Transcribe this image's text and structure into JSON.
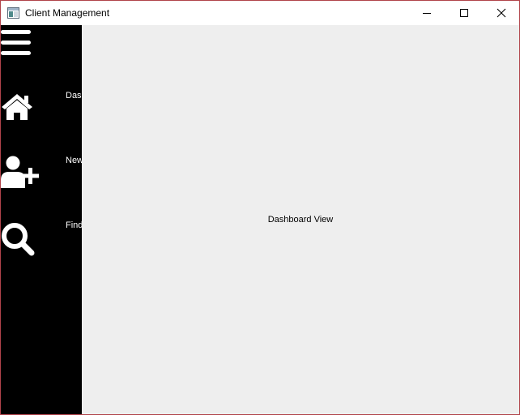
{
  "window": {
    "title": "Client Management",
    "controls": {
      "minimize": "minimize-icon",
      "maximize": "maximize-icon",
      "close": "close-icon"
    },
    "border_color": "#b0434a"
  },
  "sidebar": {
    "background": "#000000",
    "menu_icon": "hamburger-icon",
    "items": [
      {
        "icon": "home-icon",
        "label": "Dashboard"
      },
      {
        "icon": "add-user-icon",
        "label": "New"
      },
      {
        "icon": "search-icon",
        "label": "Find"
      }
    ]
  },
  "main": {
    "background": "#eeeeee",
    "view_label": "Dashboard View"
  }
}
